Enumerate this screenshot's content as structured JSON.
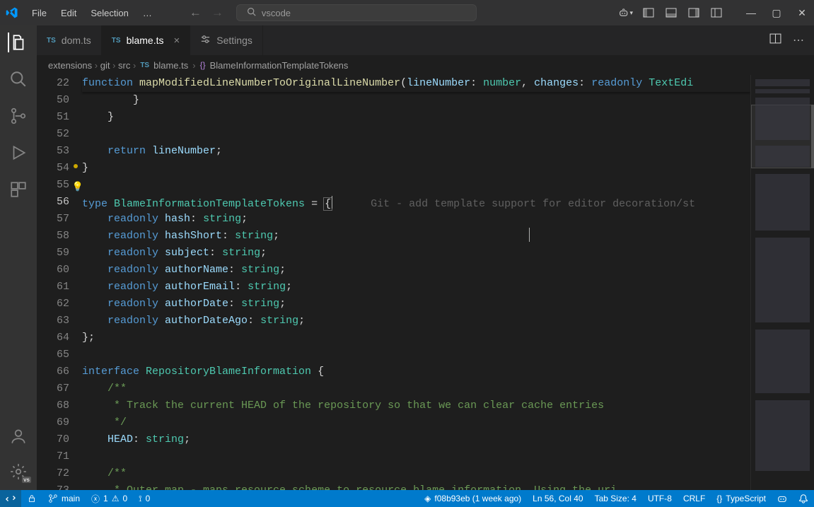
{
  "menu": {
    "file": "File",
    "edit": "Edit",
    "selection": "Selection",
    "more": "…"
  },
  "search": {
    "placeholder": "vscode"
  },
  "tabs": [
    {
      "icon": "TS",
      "label": "dom.ts",
      "active": false,
      "closable": false
    },
    {
      "icon": "TS",
      "label": "blame.ts",
      "active": true,
      "closable": true
    },
    {
      "icon": "settings",
      "label": "Settings",
      "active": false,
      "closable": false
    }
  ],
  "breadcrumbs": {
    "parts": [
      "extensions",
      "git",
      "src"
    ],
    "file_icon": "TS",
    "file": "blame.ts",
    "symbol_icon": "{}",
    "symbol": "BlameInformationTemplateTokens"
  },
  "code": {
    "sticky_line": {
      "num": 22,
      "tokens": [
        {
          "t": "kw",
          "v": "function "
        },
        {
          "t": "fn",
          "v": "mapModifiedLineNumberToOriginalLineNumber"
        },
        {
          "t": "punc",
          "v": "("
        },
        {
          "t": "param",
          "v": "lineNumber"
        },
        {
          "t": "punc",
          "v": ": "
        },
        {
          "t": "type",
          "v": "number"
        },
        {
          "t": "punc",
          "v": ", "
        },
        {
          "t": "param",
          "v": "changes"
        },
        {
          "t": "punc",
          "v": ": "
        },
        {
          "t": "kw",
          "v": "readonly "
        },
        {
          "t": "type",
          "v": "TextEdi"
        }
      ]
    },
    "lines": [
      {
        "num": 50,
        "indent": 8,
        "tokens": [
          {
            "t": "punc",
            "v": "}"
          }
        ]
      },
      {
        "num": 51,
        "indent": 4,
        "tokens": [
          {
            "t": "punc",
            "v": "}"
          }
        ]
      },
      {
        "num": 52,
        "indent": 0,
        "tokens": []
      },
      {
        "num": 53,
        "indent": 4,
        "tokens": [
          {
            "t": "kw",
            "v": "return "
          },
          {
            "t": "param",
            "v": "lineNumber"
          },
          {
            "t": "punc",
            "v": ";"
          }
        ]
      },
      {
        "num": 54,
        "indent": 0,
        "fold": true,
        "tokens": [
          {
            "t": "punc",
            "v": "}"
          }
        ]
      },
      {
        "num": 55,
        "indent": 0,
        "bulb": true,
        "tokens": []
      },
      {
        "num": 56,
        "indent": 0,
        "current": true,
        "blame": "Git - add template support for editor decoration/st",
        "tokens": [
          {
            "t": "kw",
            "v": "type "
          },
          {
            "t": "type",
            "v": "BlameInformationTemplateTokens"
          },
          {
            "t": "punc",
            "v": " = "
          },
          {
            "t": "punc",
            "v": "{",
            "hl": true
          }
        ]
      },
      {
        "num": 57,
        "indent": 4,
        "tokens": [
          {
            "t": "readonly",
            "v": "readonly "
          },
          {
            "t": "param",
            "v": "hash"
          },
          {
            "t": "punc",
            "v": ": "
          },
          {
            "t": "type",
            "v": "string"
          },
          {
            "t": "punc",
            "v": ";"
          }
        ]
      },
      {
        "num": 58,
        "indent": 4,
        "tokens": [
          {
            "t": "readonly",
            "v": "readonly "
          },
          {
            "t": "param",
            "v": "hashShort"
          },
          {
            "t": "punc",
            "v": ": "
          },
          {
            "t": "type",
            "v": "string"
          },
          {
            "t": "punc",
            "v": ";"
          }
        ]
      },
      {
        "num": 59,
        "indent": 4,
        "tokens": [
          {
            "t": "readonly",
            "v": "readonly "
          },
          {
            "t": "param",
            "v": "subject"
          },
          {
            "t": "punc",
            "v": ": "
          },
          {
            "t": "type",
            "v": "string"
          },
          {
            "t": "punc",
            "v": ";"
          }
        ]
      },
      {
        "num": 60,
        "indent": 4,
        "tokens": [
          {
            "t": "readonly",
            "v": "readonly "
          },
          {
            "t": "param",
            "v": "authorName"
          },
          {
            "t": "punc",
            "v": ": "
          },
          {
            "t": "type",
            "v": "string"
          },
          {
            "t": "punc",
            "v": ";"
          }
        ]
      },
      {
        "num": 61,
        "indent": 4,
        "tokens": [
          {
            "t": "readonly",
            "v": "readonly "
          },
          {
            "t": "param",
            "v": "authorEmail"
          },
          {
            "t": "punc",
            "v": ": "
          },
          {
            "t": "type",
            "v": "string"
          },
          {
            "t": "punc",
            "v": ";"
          }
        ]
      },
      {
        "num": 62,
        "indent": 4,
        "tokens": [
          {
            "t": "readonly",
            "v": "readonly "
          },
          {
            "t": "param",
            "v": "authorDate"
          },
          {
            "t": "punc",
            "v": ": "
          },
          {
            "t": "type",
            "v": "string"
          },
          {
            "t": "punc",
            "v": ";"
          }
        ]
      },
      {
        "num": 63,
        "indent": 4,
        "tokens": [
          {
            "t": "readonly",
            "v": "readonly "
          },
          {
            "t": "param",
            "v": "authorDateAgo"
          },
          {
            "t": "punc",
            "v": ": "
          },
          {
            "t": "type",
            "v": "string"
          },
          {
            "t": "punc",
            "v": ";"
          }
        ]
      },
      {
        "num": 64,
        "indent": 0,
        "tokens": [
          {
            "t": "punc",
            "v": "}"
          },
          {
            "t": "punc",
            "v": ";"
          }
        ]
      },
      {
        "num": 65,
        "indent": 0,
        "tokens": []
      },
      {
        "num": 66,
        "indent": 0,
        "tokens": [
          {
            "t": "kw",
            "v": "interface "
          },
          {
            "t": "interface",
            "v": "RepositoryBlameInformation"
          },
          {
            "t": "punc",
            "v": " {"
          }
        ]
      },
      {
        "num": 67,
        "indent": 4,
        "tokens": [
          {
            "t": "comment",
            "v": "/**"
          }
        ]
      },
      {
        "num": 68,
        "indent": 4,
        "tokens": [
          {
            "t": "comment",
            "v": " * Track the current HEAD of the repository so that we can clear cache entries"
          }
        ]
      },
      {
        "num": 69,
        "indent": 4,
        "tokens": [
          {
            "t": "comment",
            "v": " */"
          }
        ]
      },
      {
        "num": 70,
        "indent": 4,
        "tokens": [
          {
            "t": "param",
            "v": "HEAD"
          },
          {
            "t": "punc",
            "v": ": "
          },
          {
            "t": "type",
            "v": "string"
          },
          {
            "t": "punc",
            "v": ";"
          }
        ]
      },
      {
        "num": 71,
        "indent": 0,
        "tokens": []
      },
      {
        "num": 72,
        "indent": 4,
        "tokens": [
          {
            "t": "comment",
            "v": "/**"
          }
        ]
      },
      {
        "num": 73,
        "indent": 4,
        "tokens": [
          {
            "t": "comment",
            "v": " * Outer map - maps resource scheme to resource blame information. Using the uri"
          }
        ]
      }
    ]
  },
  "statusbar": {
    "branch": "main",
    "errors": "0",
    "errors_x": "1",
    "warnings": "0",
    "ports": "0",
    "commit": "f08b93eb (1 week ago)",
    "position": "Ln 56, Col 40",
    "tab": "Tab Size: 4",
    "encoding": "UTF-8",
    "eol": "CRLF",
    "lang_icon": "{}",
    "lang": "TypeScript"
  }
}
